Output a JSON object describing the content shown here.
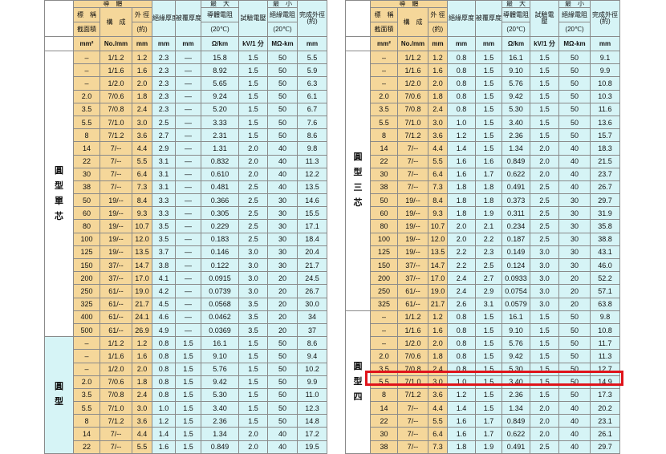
{
  "columns": {
    "top_conductor": "導　體",
    "top_max": "最　大",
    "top_min": "最　小",
    "nominal": "標　稱",
    "nominal_sub": "截面積",
    "construction": "構　成",
    "od": "外 徑",
    "od_sub": "(約)",
    "insul": "絕緣厚度",
    "sheath": "被覆厚度",
    "resist": "導體電阻",
    "resist_sub": "(20℃)",
    "test": "試驗電壓",
    "test_right_a": "試驗電",
    "test_right_b": "壓",
    "ins_res": "絕緣電阻",
    "ins_res_sub": "(20℃)",
    "finish": "完成外徑",
    "finish_sub": "(約)"
  },
  "units": [
    "mm²",
    "No./mm",
    "mm",
    "mm",
    "mm",
    "Ω/km",
    "kV/1 分",
    "MΩ-km",
    "mm"
  ],
  "left": {
    "group1_label": [
      "圓",
      "型",
      "單",
      "芯"
    ],
    "group2_label": [
      "圓",
      "型"
    ],
    "group1_rows": [
      [
        "–",
        "1/1.2",
        "1.2",
        "2.3",
        "—",
        "15.8",
        "1.5",
        "50",
        "5.5"
      ],
      [
        "–",
        "1/1.6",
        "1.6",
        "2.3",
        "—",
        "8.92",
        "1.5",
        "50",
        "5.9"
      ],
      [
        "–",
        "1/2.0",
        "2.0",
        "2.3",
        "—",
        "5.65",
        "1.5",
        "50",
        "6.3"
      ],
      [
        "2.0",
        "7/0.6",
        "1.8",
        "2.3",
        "—",
        "9.24",
        "1.5",
        "50",
        "6.1"
      ],
      [
        "3.5",
        "7/0.8",
        "2.4",
        "2.3",
        "—",
        "5.20",
        "1.5",
        "50",
        "6.7"
      ],
      [
        "5.5",
        "7/1.0",
        "3.0",
        "2.5",
        "—",
        "3.33",
        "1.5",
        "50",
        "7.6"
      ],
      [
        "8",
        "7/1.2",
        "3.6",
        "2.7",
        "—",
        "2.31",
        "1.5",
        "50",
        "8.6"
      ],
      [
        "14",
        "7/--",
        "4.4",
        "2.9",
        "—",
        "1.31",
        "2.0",
        "40",
        "9.8"
      ],
      [
        "22",
        "7/--",
        "5.5",
        "3.1",
        "—",
        "0.832",
        "2.0",
        "40",
        "11.3"
      ],
      [
        "30",
        "7/--",
        "6.4",
        "3.1",
        "—",
        "0.610",
        "2.0",
        "40",
        "12.2"
      ],
      [
        "38",
        "7/--",
        "7.3",
        "3.1",
        "—",
        "0.481",
        "2.5",
        "40",
        "13.5"
      ],
      [
        "50",
        "19/--",
        "8.4",
        "3.3",
        "—",
        "0.366",
        "2.5",
        "30",
        "14.6"
      ],
      [
        "60",
        "19/--",
        "9.3",
        "3.3",
        "—",
        "0.305",
        "2.5",
        "30",
        "15.5"
      ],
      [
        "80",
        "19/--",
        "10.7",
        "3.5",
        "—",
        "0.229",
        "2.5",
        "30",
        "17.1"
      ],
      [
        "100",
        "19/--",
        "12.0",
        "3.5",
        "—",
        "0.183",
        "2.5",
        "30",
        "18.4"
      ],
      [
        "125",
        "19/--",
        "13.5",
        "3.7",
        "—",
        "0.146",
        "3.0",
        "30",
        "20.4"
      ],
      [
        "150",
        "37/--",
        "14.7",
        "3.8",
        "—",
        "0.122",
        "3.0",
        "30",
        "21.7"
      ],
      [
        "200",
        "37/--",
        "17.0",
        "4.1",
        "—",
        "0.0915",
        "3.0",
        "20",
        "24.5"
      ],
      [
        "250",
        "61/--",
        "19.0",
        "4.2",
        "—",
        "0.0739",
        "3.0",
        "20",
        "26.7"
      ],
      [
        "325",
        "61/--",
        "21.7",
        "4.5",
        "—",
        "0.0568",
        "3.5",
        "20",
        "30.0"
      ],
      [
        "400",
        "61/--",
        "24.1",
        "4.6",
        "—",
        "0.0462",
        "3.5",
        "20",
        "34"
      ],
      [
        "500",
        "61/--",
        "26.9",
        "4.9",
        "—",
        "0.0369",
        "3.5",
        "20",
        "37"
      ]
    ],
    "group2_rows": [
      [
        "–",
        "1/1.2",
        "1.2",
        "0.8",
        "1.5",
        "16.1",
        "1.5",
        "50",
        "8.6"
      ],
      [
        "–",
        "1/1.6",
        "1.6",
        "0.8",
        "1.5",
        "9.10",
        "1.5",
        "50",
        "9.4"
      ],
      [
        "–",
        "1/2.0",
        "2.0",
        "0.8",
        "1.5",
        "5.76",
        "1.5",
        "50",
        "10.2"
      ],
      [
        "2.0",
        "7/0.6",
        "1.8",
        "0.8",
        "1.5",
        "9.42",
        "1.5",
        "50",
        "9.9"
      ],
      [
        "3.5",
        "7/0.8",
        "2.4",
        "0.8",
        "1.5",
        "5.30",
        "1.5",
        "50",
        "11.0"
      ],
      [
        "5.5",
        "7/1.0",
        "3.0",
        "1.0",
        "1.5",
        "3.40",
        "1.5",
        "50",
        "12.3"
      ],
      [
        "8",
        "7/1.2",
        "3.6",
        "1.2",
        "1.5",
        "2.36",
        "1.5",
        "50",
        "14.8"
      ],
      [
        "14",
        "7/--",
        "4.4",
        "1.4",
        "1.5",
        "1.34",
        "2.0",
        "40",
        "17.2"
      ],
      [
        "22",
        "7/--",
        "5.5",
        "1.6",
        "1.5",
        "0.849",
        "2.0",
        "40",
        "19.5"
      ]
    ]
  },
  "right": {
    "group1_label": [
      "圓",
      "型",
      "三",
      "芯"
    ],
    "group2_label": [
      "圓",
      "型",
      "四"
    ],
    "group1_rows": [
      [
        "–",
        "1/1.2",
        "1.2",
        "0.8",
        "1.5",
        "16.1",
        "1.5",
        "50",
        "9.1"
      ],
      [
        "–",
        "1/1.6",
        "1.6",
        "0.8",
        "1.5",
        "9.10",
        "1.5",
        "50",
        "9.9"
      ],
      [
        "–",
        "1/2.0",
        "2.0",
        "0.8",
        "1.5",
        "5.76",
        "1.5",
        "50",
        "10.8"
      ],
      [
        "2.0",
        "7/0.6",
        "1.8",
        "0.8",
        "1.5",
        "9.42",
        "1.5",
        "50",
        "10.3"
      ],
      [
        "3.5",
        "7/0.8",
        "2.4",
        "0.8",
        "1.5",
        "5.30",
        "1.5",
        "50",
        "11.6"
      ],
      [
        "5.5",
        "7/1.0",
        "3.0",
        "1.0",
        "1.5",
        "3.40",
        "1.5",
        "50",
        "13.6"
      ],
      [
        "8",
        "7/1.2",
        "3.6",
        "1.2",
        "1.5",
        "2.36",
        "1.5",
        "50",
        "15.7"
      ],
      [
        "14",
        "7/--",
        "4.4",
        "1.4",
        "1.5",
        "1.34",
        "2.0",
        "40",
        "18.3"
      ],
      [
        "22",
        "7/--",
        "5.5",
        "1.6",
        "1.6",
        "0.849",
        "2.0",
        "40",
        "21.5"
      ],
      [
        "30",
        "7/--",
        "6.4",
        "1.6",
        "1.7",
        "0.622",
        "2.0",
        "40",
        "23.7"
      ],
      [
        "38",
        "7/--",
        "7.3",
        "1.8",
        "1.8",
        "0.491",
        "2.5",
        "40",
        "26.7"
      ],
      [
        "50",
        "19/--",
        "8.4",
        "1.8",
        "1.8",
        "0.373",
        "2.5",
        "30",
        "29.7"
      ],
      [
        "60",
        "19/--",
        "9.3",
        "1.8",
        "1.9",
        "0.311",
        "2.5",
        "30",
        "31.9"
      ],
      [
        "80",
        "19/--",
        "10.7",
        "2.0",
        "2.1",
        "0.234",
        "2.5",
        "30",
        "35.8"
      ],
      [
        "100",
        "19/--",
        "12.0",
        "2.0",
        "2.2",
        "0.187",
        "2.5",
        "30",
        "38.8"
      ],
      [
        "125",
        "19/--",
        "13.5",
        "2.2",
        "2.3",
        "0.149",
        "3.0",
        "30",
        "43.1"
      ],
      [
        "150",
        "37/--",
        "14.7",
        "2.2",
        "2.5",
        "0.124",
        "3.0",
        "30",
        "46.0"
      ],
      [
        "200",
        "37/--",
        "17.0",
        "2.4",
        "2.7",
        "0.0933",
        "3.0",
        "20",
        "52.2"
      ],
      [
        "250",
        "61/--",
        "19.0",
        "2.4",
        "2.9",
        "0.0754",
        "3.0",
        "20",
        "57.1"
      ],
      [
        "325",
        "61/--",
        "21.7",
        "2.6",
        "3.1",
        "0.0579",
        "3.0",
        "20",
        "63.8"
      ]
    ],
    "group2_rows": [
      [
        "–",
        "1/1.2",
        "1.2",
        "0.8",
        "1.5",
        "16.1",
        "1.5",
        "50",
        "9.8"
      ],
      [
        "–",
        "1/1.6",
        "1.6",
        "0.8",
        "1.5",
        "9.10",
        "1.5",
        "50",
        "10.8"
      ],
      [
        "–",
        "1/2.0",
        "2.0",
        "0.8",
        "1.5",
        "5.76",
        "1.5",
        "50",
        "11.7"
      ],
      [
        "2.0",
        "7/0.6",
        "1.8",
        "0.8",
        "1.5",
        "9.42",
        "1.5",
        "50",
        "11.3"
      ],
      [
        "3.5",
        "7/0.8",
        "2.4",
        "0.8",
        "1.5",
        "5.30",
        "1.5",
        "50",
        "12.7"
      ],
      [
        "5.5",
        "7/1.0",
        "3.0",
        "1.0",
        "1.5",
        "3.40",
        "1.5",
        "50",
        "14.9"
      ],
      [
        "8",
        "7/1.2",
        "3.6",
        "1.2",
        "1.5",
        "2.36",
        "1.5",
        "50",
        "17.3"
      ],
      [
        "14",
        "7/--",
        "4.4",
        "1.4",
        "1.5",
        "1.34",
        "2.0",
        "40",
        "20.2"
      ],
      [
        "22",
        "7/--",
        "5.5",
        "1.6",
        "1.7",
        "0.849",
        "2.0",
        "40",
        "23.1"
      ],
      [
        "30",
        "7/--",
        "6.4",
        "1.6",
        "1.7",
        "0.622",
        "2.0",
        "40",
        "26.1"
      ],
      [
        "38",
        "7/--",
        "7.3",
        "1.8",
        "1.9",
        "0.491",
        "2.5",
        "40",
        "29.7"
      ]
    ]
  },
  "highlight_color": "#e0141b"
}
